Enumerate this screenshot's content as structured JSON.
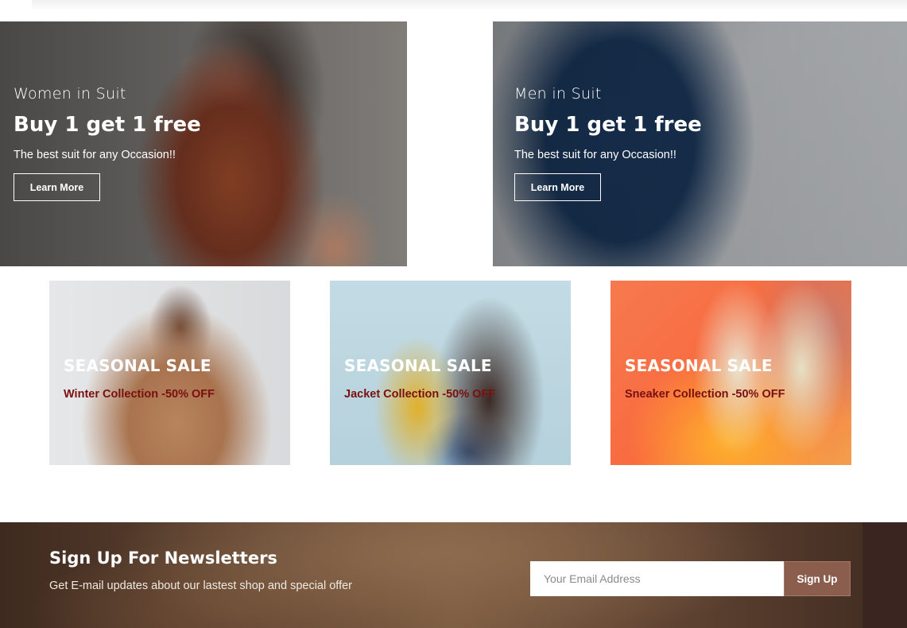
{
  "promo_banners": [
    {
      "kicker": "Women in Suit",
      "headline": "Buy 1 get 1 free",
      "subtext": "The best suit for any Occasion!!",
      "button_label": "Learn More"
    },
    {
      "kicker": "Men in Suit",
      "headline": "Buy 1 get 1 free",
      "subtext": "The best suit for any Occasion!!",
      "button_label": "Learn More"
    }
  ],
  "seasonal_cards": [
    {
      "title": "SEASONAL SALE",
      "subtitle": "Winter Collection -50% OFF"
    },
    {
      "title": "SEASONAL SALE",
      "subtitle": "Jacket Collection -50% OFF"
    },
    {
      "title": "SEASONAL SALE",
      "subtitle": "Sneaker Collection -50% OFF"
    }
  ],
  "newsletter": {
    "title": "Sign Up For Newsletters",
    "subtitle": "Get E-mail updates about our lastest shop and special offer",
    "email_placeholder": "Your Email Address",
    "button_label": "Sign Up"
  },
  "colors": {
    "sale_subtitle": "#7a0f0f",
    "signup_button": "#8b5d4c"
  }
}
